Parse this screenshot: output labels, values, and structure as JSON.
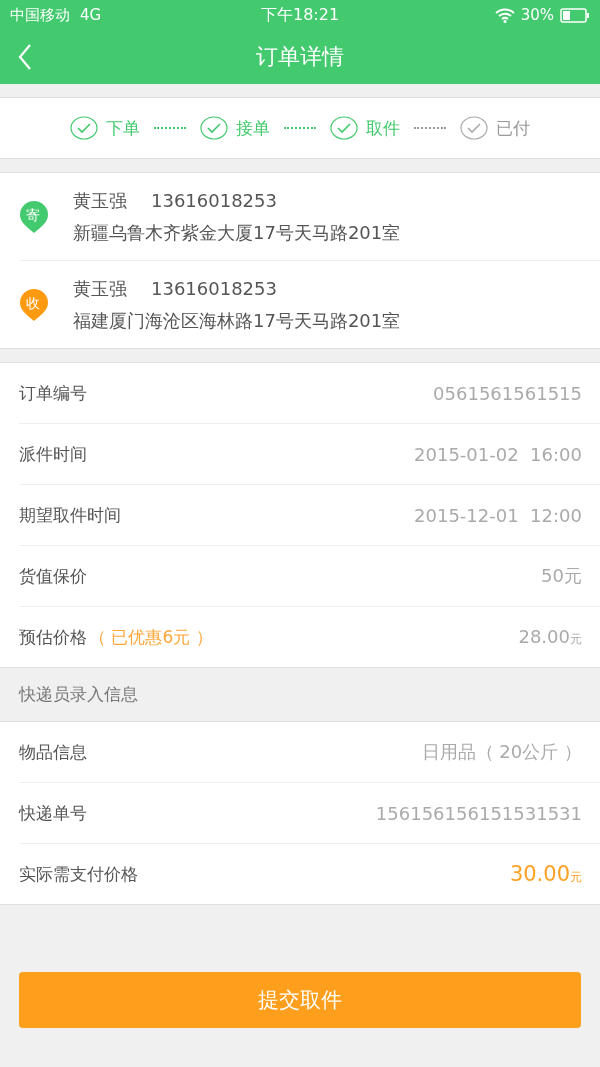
{
  "status_bar": {
    "carrier": "中国移动",
    "network": "4G",
    "time": "下午18:21",
    "battery": "30%"
  },
  "header": {
    "title": "订单详情"
  },
  "steps": [
    {
      "label": "下单",
      "done": true
    },
    {
      "label": "接单",
      "done": true
    },
    {
      "label": "取件",
      "done": true
    },
    {
      "label": "已付",
      "done": false
    }
  ],
  "addresses": [
    {
      "kind": "sender",
      "badge": "寄",
      "name": "黄玉强",
      "phone": "13616018253",
      "address": "新疆乌鲁木齐紫金大厦17号天马路201室"
    },
    {
      "kind": "receiver",
      "badge": "收",
      "name": "黄玉强",
      "phone": "13616018253",
      "address": "福建厦门海沧区海林路17号天马路201室"
    }
  ],
  "order_rows": [
    {
      "label": "订单编号",
      "value": "0561561561515",
      "highlight": false
    },
    {
      "label": "派件时间",
      "value": "2015-01-02  16:00",
      "highlight": false
    },
    {
      "label": "期望取件时间",
      "value": "2015-12-01  12:00",
      "highlight": false
    },
    {
      "label": "货值保价",
      "value": "50元",
      "highlight": false
    },
    {
      "label": "预估价格",
      "note": "（ 已优惠6元 ）",
      "value": "28.00",
      "unit": "元",
      "highlight": false
    }
  ],
  "courier_section": {
    "title": "快递员录入信息"
  },
  "courier_rows": [
    {
      "label": "物品信息",
      "value": "日用品（ 20公斤 ）",
      "highlight": false
    },
    {
      "label": "快递单号",
      "value": "156156156151531531",
      "highlight": false
    },
    {
      "label": "实际需支付价格",
      "value": "30.00",
      "unit": "元",
      "highlight": true
    }
  ],
  "submit_button": "提交取件"
}
